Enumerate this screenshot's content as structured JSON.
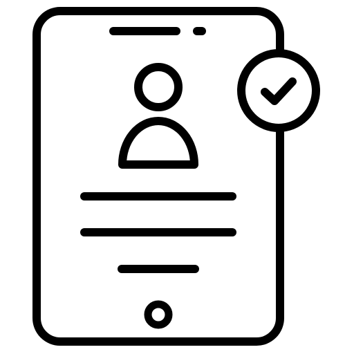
{
  "icon": {
    "name": "verified-user-profile-tablet-icon",
    "stroke_color": "#000000",
    "fill_color": "#ffffff",
    "parts": [
      "tablet-body-icon",
      "speaker-slot-icon",
      "camera-dot-icon",
      "user-avatar-icon",
      "text-line-icon",
      "home-button-icon",
      "checkmark-badge-icon"
    ]
  }
}
